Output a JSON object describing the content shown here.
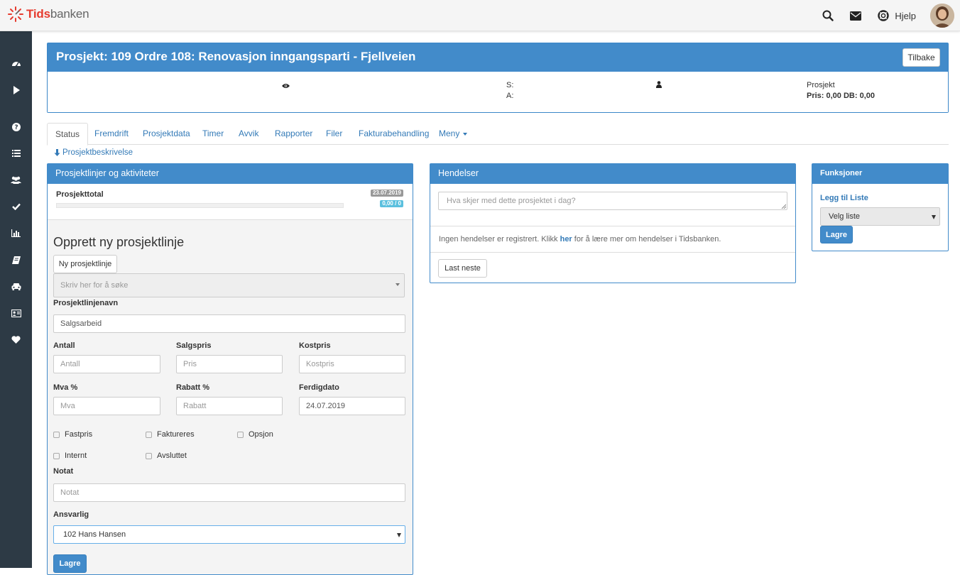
{
  "brand": {
    "logo_text_bold": "Tids",
    "logo_text_rest": "banken",
    "logo_color": "#e63c2f"
  },
  "topbar": {
    "help_label": "Hjelp",
    "icons": [
      "search-icon",
      "envelope-icon",
      "lifebuoy-icon",
      "avatar"
    ]
  },
  "sidebar": {
    "icons": [
      "dashboard-icon",
      "play-icon",
      "question-icon",
      "list-icon",
      "users-icon",
      "check-icon",
      "bar-chart-icon",
      "book-icon",
      "car-icon",
      "id-card-icon",
      "heart-icon"
    ]
  },
  "project": {
    "title": "Prosjekt: 109 Ordre 108: Renovasjon inngangsparti - Fjellveien",
    "back_label": "Tilbake",
    "s_label": "S:",
    "a_label": "A:",
    "type_label": "Prosjekt",
    "price_line": "Pris: 0,00 DB: 0,00"
  },
  "tabs": [
    {
      "label": "Status",
      "active": true
    },
    {
      "label": "Fremdrift"
    },
    {
      "label": "Prosjektdata"
    },
    {
      "label": "Timer"
    },
    {
      "label": "Avvik"
    },
    {
      "label": "Rapporter"
    },
    {
      "label": "Filer"
    },
    {
      "label": "Fakturabehandling"
    },
    {
      "label": "Meny"
    }
  ],
  "description_link": "Prosjektbeskrivelse",
  "lines_panel": {
    "title": "Prosjektlinjer og aktiviteter",
    "total_label": "Prosjekttotal",
    "date_badge": "23.07.2019",
    "value_badge": "0,00 / 0",
    "progress": 0,
    "create_heading": "Opprett ny prosjektlinje",
    "new_line_button": "Ny prosjektlinje",
    "search_placeholder": "Skriv her for å søke",
    "name_label": "Prosjektlinjenavn",
    "name_value": "Salgsarbeid",
    "fields": {
      "antall_label": "Antall",
      "antall_placeholder": "Antall",
      "salgspris_label": "Salgspris",
      "salgspris_placeholder": "Pris",
      "kostpris_label": "Kostpris",
      "kostpris_placeholder": "Kostpris",
      "mva_label": "Mva %",
      "mva_placeholder": "Mva",
      "rabatt_label": "Rabatt %",
      "rabatt_placeholder": "Rabatt",
      "ferdig_label": "Ferdigdato",
      "ferdig_value": "24.07.2019"
    },
    "checkboxes": {
      "fastpris": "Fastpris",
      "faktureres": "Faktureres",
      "opsjon": "Opsjon",
      "internt": "Internt",
      "avsluttet": "Avsluttet"
    },
    "notat_label": "Notat",
    "notat_placeholder": "Notat",
    "ansvarlig_label": "Ansvarlig",
    "ansvarlig_value": "102 Hans Hansen",
    "save_label": "Lagre"
  },
  "events_panel": {
    "title": "Hendelser",
    "input_placeholder": "Hva skjer med dette prosjektet i dag?",
    "empty_text_before": "Ingen hendelser er registrert. Klikk ",
    "empty_link": "her",
    "empty_text_after": " for å lære mer om hendelser i Tidsbanken.",
    "load_next_label": "Last neste"
  },
  "functions_panel": {
    "title": "Funksjoner",
    "add_to_list_link": "Legg til Liste",
    "select_value": "Velg liste",
    "save_label": "Lagre"
  },
  "colors": {
    "primary": "#428bca",
    "sidebar": "#2d3a45",
    "badge_grey": "#999999",
    "badge_blue": "#5bc0de"
  }
}
